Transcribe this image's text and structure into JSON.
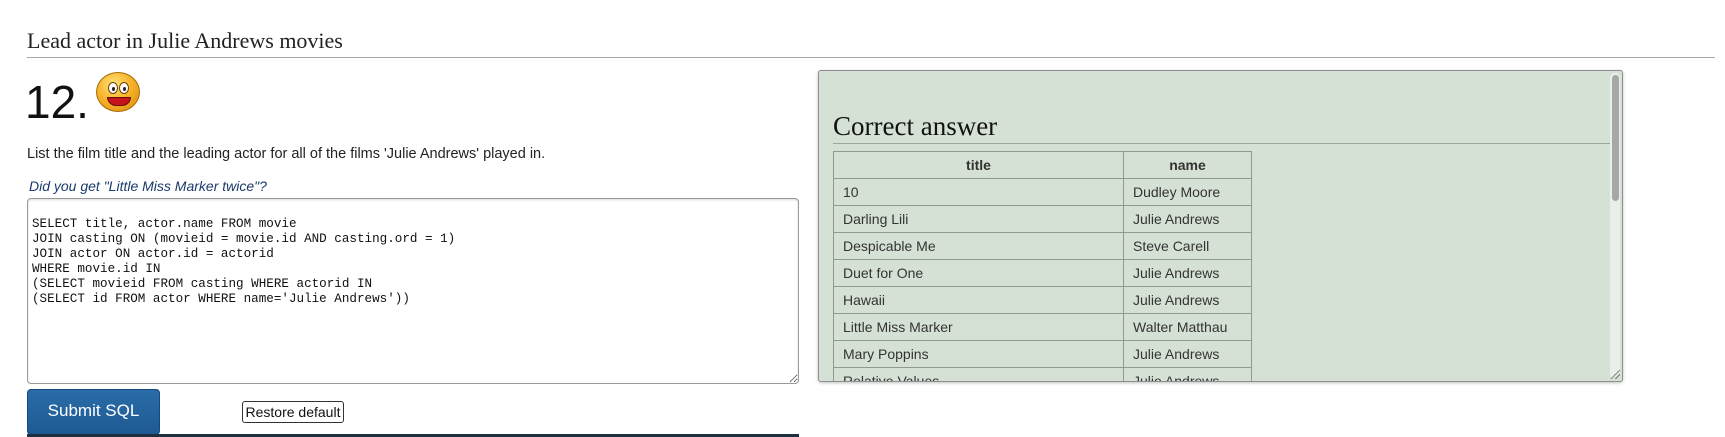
{
  "section_title": "Lead actor in Julie Andrews movies",
  "question": {
    "number": "12.",
    "text": "List the film title and the leading actor for all of the films 'Julie Andrews' played in.",
    "hint": "Did you get \"Little Miss Marker twice\"?"
  },
  "editor": {
    "sql": "SELECT title, actor.name FROM movie\nJOIN casting ON (movieid = movie.id AND casting.ord = 1)\nJOIN actor ON actor.id = actorid\nWHERE movie.id IN\n(SELECT movieid FROM casting WHERE actorid IN\n(SELECT id FROM actor WHERE name='Julie Andrews'))"
  },
  "buttons": {
    "submit_label": "Submit SQL",
    "restore_label": "Restore default"
  },
  "answer": {
    "title": "Correct answer",
    "columns": [
      "title",
      "name"
    ],
    "rows": [
      [
        "10",
        "Dudley Moore"
      ],
      [
        "Darling Lili",
        "Julie Andrews"
      ],
      [
        "Despicable Me",
        "Steve Carell"
      ],
      [
        "Duet for One",
        "Julie Andrews"
      ],
      [
        "Hawaii",
        "Julie Andrews"
      ],
      [
        "Little Miss Marker",
        "Walter Matthau"
      ],
      [
        "Mary Poppins",
        "Julie Andrews"
      ],
      [
        "Relative Values",
        "Julie Andrews"
      ]
    ]
  },
  "colors": {
    "panel_bg": "#d6e1d6",
    "submit_bg": "#1e5a93",
    "hint_text": "#1a3a6b"
  },
  "icons": {
    "smiley": "smiley-face-icon"
  }
}
